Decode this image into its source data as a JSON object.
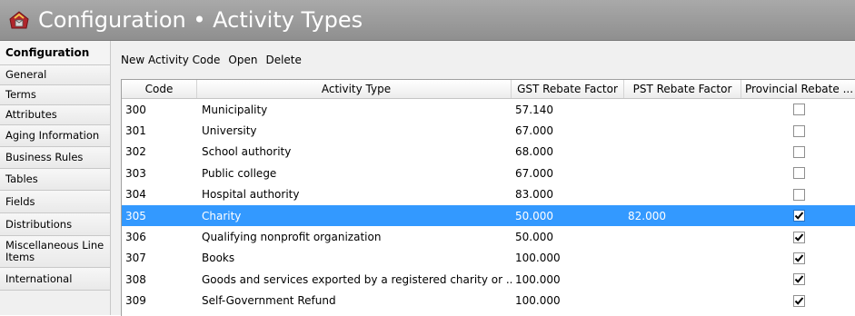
{
  "window": {
    "title": "Configuration • Activity Types"
  },
  "sidebar": {
    "items": [
      {
        "label": "Configuration",
        "header": true
      },
      {
        "label": "General"
      },
      {
        "label": "Terms"
      },
      {
        "label": "Attributes"
      },
      {
        "label": "Aging Information"
      },
      {
        "label": "Business Rules"
      },
      {
        "label": "Tables"
      },
      {
        "label": "Fields"
      },
      {
        "label": "Distributions"
      },
      {
        "label": "Miscellaneous Line Items"
      },
      {
        "label": "International"
      }
    ]
  },
  "toolbar": {
    "new_label": "New Activity Code",
    "open_label": "Open",
    "delete_label": "Delete"
  },
  "grid": {
    "columns": [
      "Code",
      "Activity Type",
      "GST Rebate Factor",
      "PST Rebate Factor",
      "Provincial Rebate ..."
    ],
    "rows": [
      {
        "code": "300",
        "type": "Municipality",
        "gst": "57.140",
        "pst": "",
        "provincial": false,
        "selected": false
      },
      {
        "code": "301",
        "type": "University",
        "gst": "67.000",
        "pst": "",
        "provincial": false,
        "selected": false
      },
      {
        "code": "302",
        "type": "School authority",
        "gst": "68.000",
        "pst": "",
        "provincial": false,
        "selected": false
      },
      {
        "code": "303",
        "type": "Public college",
        "gst": "67.000",
        "pst": "",
        "provincial": false,
        "selected": false
      },
      {
        "code": "304",
        "type": "Hospital authority",
        "gst": "83.000",
        "pst": "",
        "provincial": false,
        "selected": false
      },
      {
        "code": "305",
        "type": "Charity",
        "gst": "50.000",
        "pst": "82.000",
        "provincial": true,
        "selected": true
      },
      {
        "code": "306",
        "type": "Qualifying nonprofit organization",
        "gst": "50.000",
        "pst": "",
        "provincial": true,
        "selected": false
      },
      {
        "code": "307",
        "type": "Books",
        "gst": "100.000",
        "pst": "",
        "provincial": true,
        "selected": false
      },
      {
        "code": "308",
        "type": "Goods and services exported by a registered charity or ...",
        "gst": "100.000",
        "pst": "",
        "provincial": true,
        "selected": false
      },
      {
        "code": "309",
        "type": "Self-Government Refund",
        "gst": "100.000",
        "pst": "",
        "provincial": true,
        "selected": false
      }
    ]
  },
  "colors": {
    "title_bar": "#9a9a9a",
    "selection": "#3399ff"
  }
}
